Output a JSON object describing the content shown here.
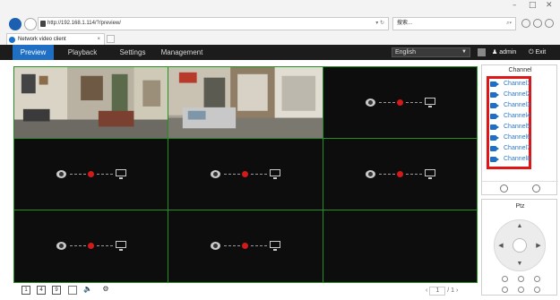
{
  "browser": {
    "url": "http://192.168.1.114/?/preview/",
    "search_text": "搜索...",
    "tab_title": "Network video client",
    "tab_close": "×"
  },
  "nav": {
    "tabs": [
      "Preview",
      "Playback",
      "Settings",
      "Management"
    ],
    "language": "English",
    "user": "admin",
    "exit": "Exit"
  },
  "sidebar": {
    "title": "Channel",
    "channels": [
      "Channel1",
      "Channel2",
      "Channel3",
      "Channel4",
      "Channel5",
      "Channel6",
      "Channel7",
      "Channel8"
    ]
  },
  "ptz": {
    "title": "Ptz"
  },
  "bottom": {
    "layout_buttons": [
      "1",
      "4",
      "9"
    ],
    "page_current": "1",
    "page_total": "/ 1"
  },
  "colors": {
    "accent": "#1f6fc4",
    "highlight_box": "#e01616",
    "cell_border": "#249024"
  }
}
